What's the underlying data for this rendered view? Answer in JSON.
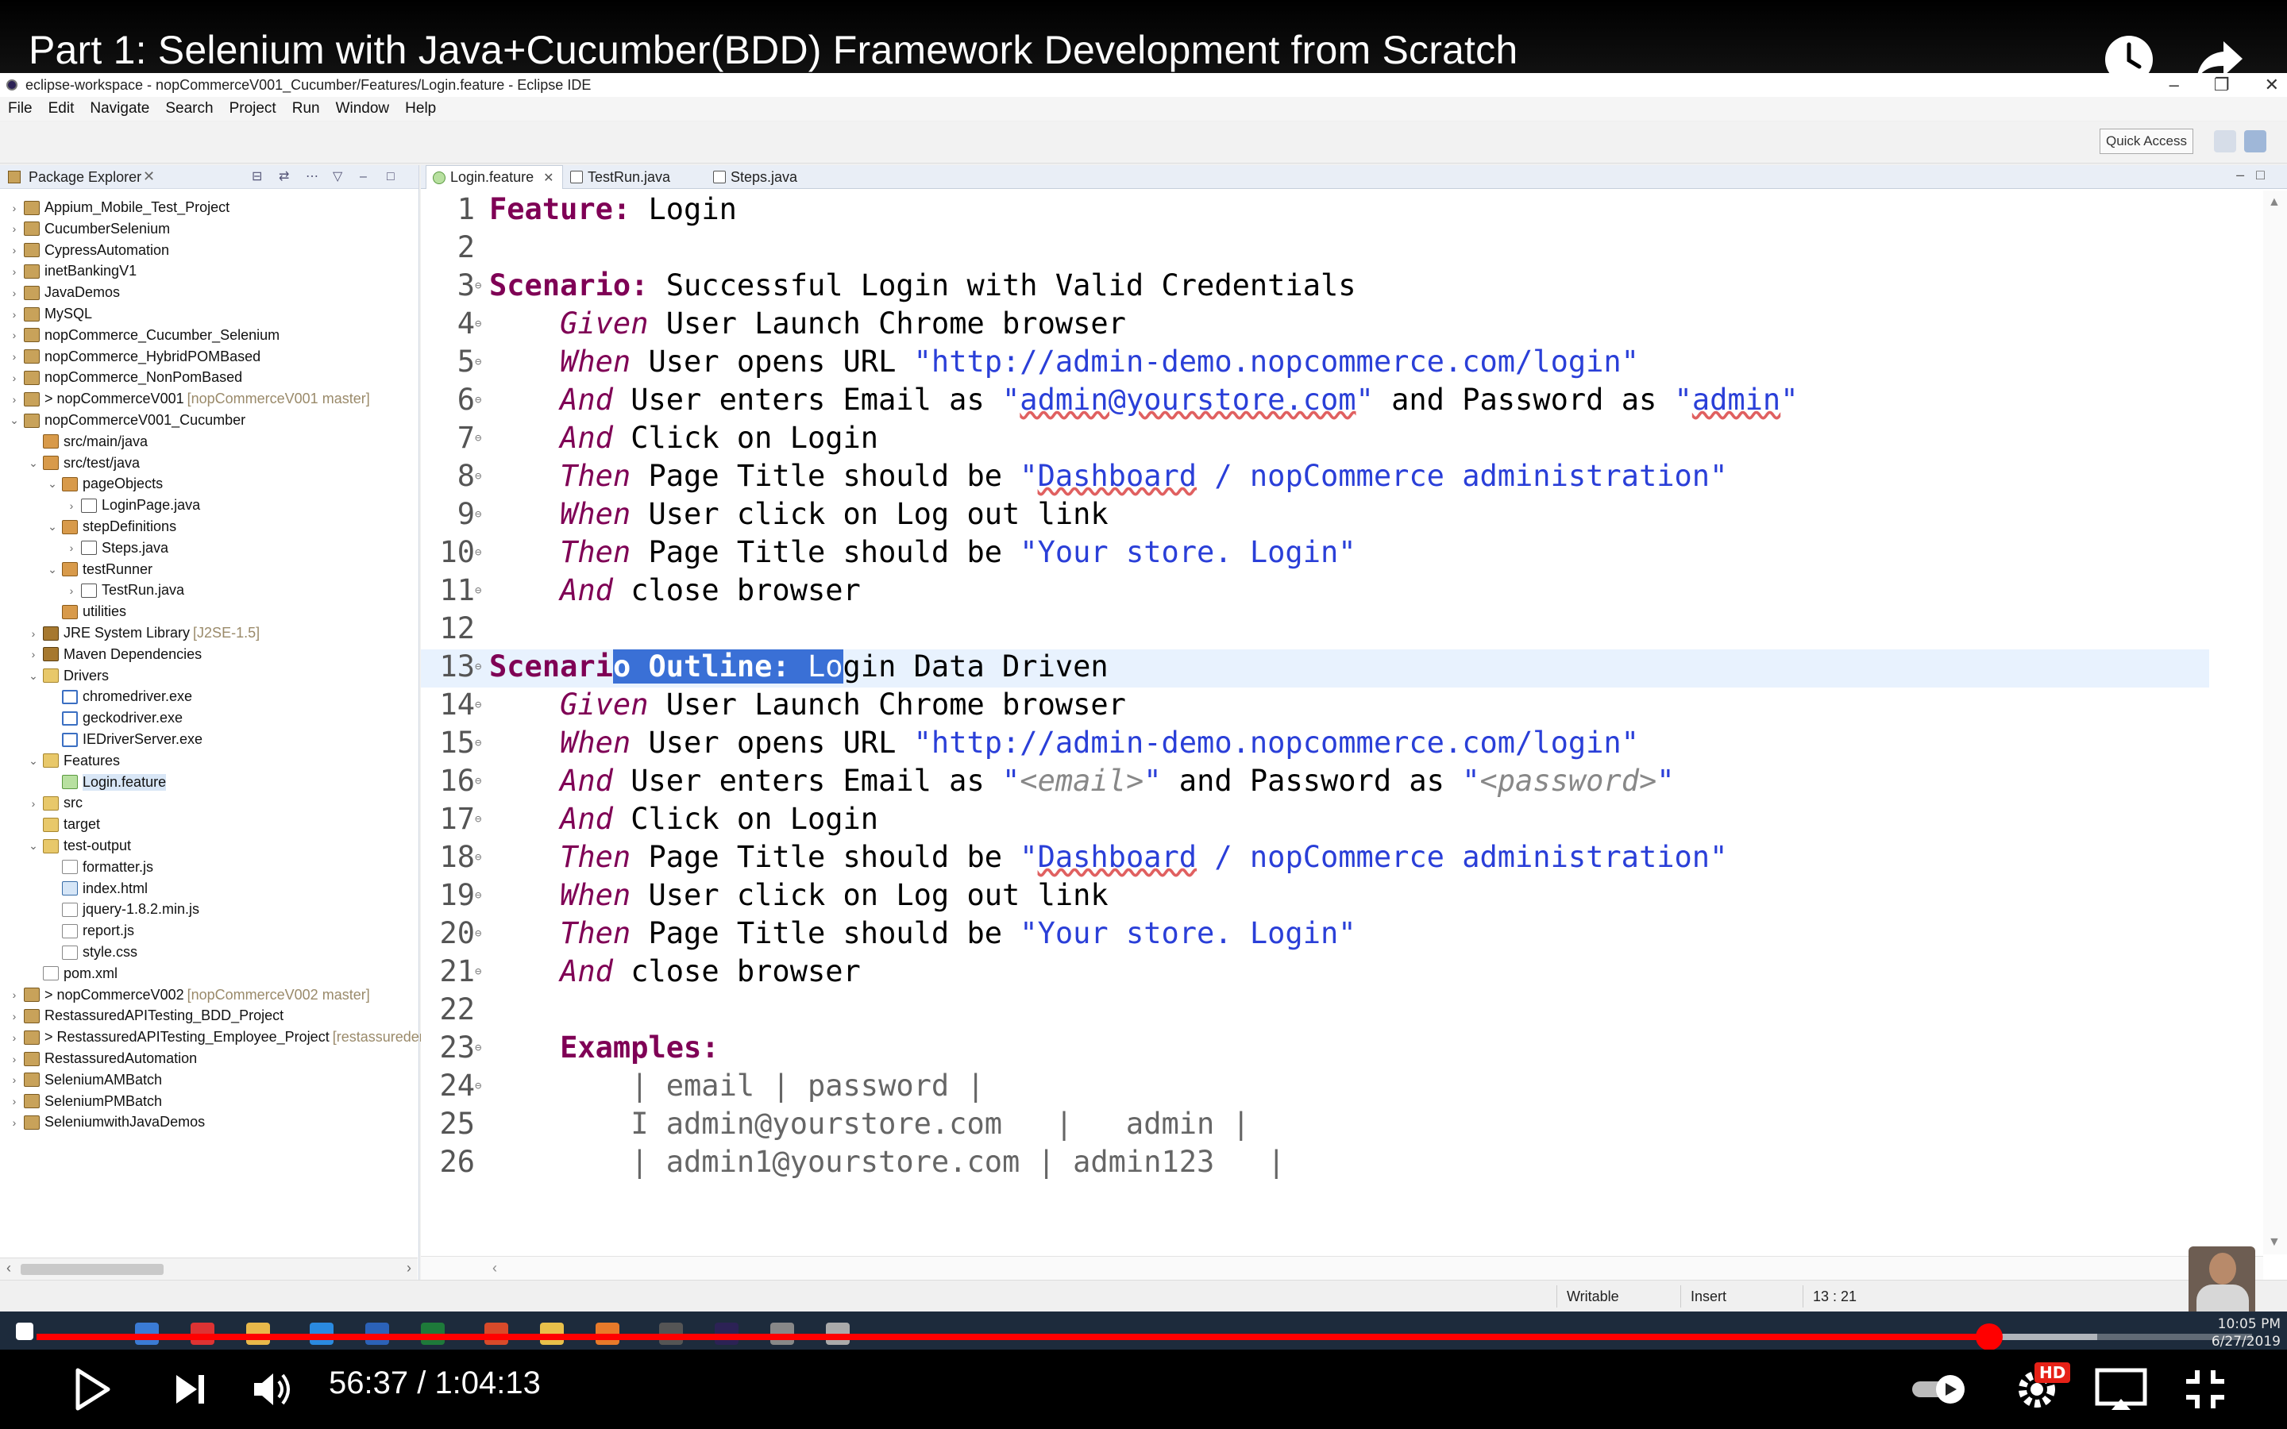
{
  "video": {
    "title": "Part 1: Selenium with Java+Cucumber(BDD) Framework Development from Scratch",
    "current_time": "56:37",
    "duration": "1:04:13",
    "time_display": "56:37 / 1:04:13",
    "progress_fraction": 0.8814,
    "buffered_fraction": 0.93,
    "hd_badge": "HD",
    "colors": {
      "progress": "#ff0000",
      "background": "#000000"
    }
  },
  "eclipse": {
    "window_title": "eclipse-workspace - nopCommerceV001_Cucumber/Features/Login.feature - Eclipse IDE",
    "menu": [
      "File",
      "Edit",
      "Navigate",
      "Search",
      "Project",
      "Run",
      "Window",
      "Help"
    ],
    "quick_access": "Quick Access",
    "package_explorer_title": "Package Explorer",
    "tree": [
      {
        "label": "Appium_Mobile_Test_Project",
        "depth": 0,
        "arrow": "›",
        "icon": "project"
      },
      {
        "label": "CucumberSelenium",
        "depth": 0,
        "arrow": "›",
        "icon": "project"
      },
      {
        "label": "CypressAutomation",
        "depth": 0,
        "arrow": "›",
        "icon": "project"
      },
      {
        "label": "inetBankingV1",
        "depth": 0,
        "arrow": "›",
        "icon": "project"
      },
      {
        "label": "JavaDemos",
        "depth": 0,
        "arrow": "›",
        "icon": "project"
      },
      {
        "label": "MySQL",
        "depth": 0,
        "arrow": "›",
        "icon": "project"
      },
      {
        "label": "nopCommerce_Cucumber_Selenium",
        "depth": 0,
        "arrow": "›",
        "icon": "project"
      },
      {
        "label": "nopCommerce_HybridPOMBased",
        "depth": 0,
        "arrow": "›",
        "icon": "project"
      },
      {
        "label": "nopCommerce_NonPomBased",
        "depth": 0,
        "arrow": "›",
        "icon": "project"
      },
      {
        "label": "> nopCommerceV001",
        "extra": "[nopCommerceV001 master]",
        "depth": 0,
        "arrow": "›",
        "icon": "project"
      },
      {
        "label": "nopCommerceV001_Cucumber",
        "depth": 0,
        "arrow": "⌄",
        "icon": "project"
      },
      {
        "label": "src/main/java",
        "depth": 1,
        "arrow": "",
        "icon": "package"
      },
      {
        "label": "src/test/java",
        "depth": 1,
        "arrow": "⌄",
        "icon": "package"
      },
      {
        "label": "pageObjects",
        "depth": 2,
        "arrow": "⌄",
        "icon": "package"
      },
      {
        "label": "LoginPage.java",
        "depth": 3,
        "arrow": "›",
        "icon": "java"
      },
      {
        "label": "stepDefinitions",
        "depth": 2,
        "arrow": "⌄",
        "icon": "package"
      },
      {
        "label": "Steps.java",
        "depth": 3,
        "arrow": "›",
        "icon": "java"
      },
      {
        "label": "testRunner",
        "depth": 2,
        "arrow": "⌄",
        "icon": "package"
      },
      {
        "label": "TestRun.java",
        "depth": 3,
        "arrow": "›",
        "icon": "java"
      },
      {
        "label": "utilities",
        "depth": 2,
        "arrow": "",
        "icon": "package"
      },
      {
        "label": "JRE System Library",
        "extra": "[J2SE-1.5]",
        "depth": 1,
        "arrow": "›",
        "icon": "lib"
      },
      {
        "label": "Maven Dependencies",
        "depth": 1,
        "arrow": "›",
        "icon": "lib"
      },
      {
        "label": "Drivers",
        "depth": 1,
        "arrow": "⌄",
        "icon": "folder"
      },
      {
        "label": "chromedriver.exe",
        "depth": 2,
        "arrow": "",
        "icon": "exe"
      },
      {
        "label": "geckodriver.exe",
        "depth": 2,
        "arrow": "",
        "icon": "exe"
      },
      {
        "label": "IEDriverServer.exe",
        "depth": 2,
        "arrow": "",
        "icon": "exe"
      },
      {
        "label": "Features",
        "depth": 1,
        "arrow": "⌄",
        "icon": "folder"
      },
      {
        "label": "Login.feature",
        "depth": 2,
        "arrow": "",
        "icon": "feature",
        "selected": true
      },
      {
        "label": "src",
        "depth": 1,
        "arrow": "›",
        "icon": "folder"
      },
      {
        "label": "target",
        "depth": 1,
        "arrow": "",
        "icon": "folder"
      },
      {
        "label": "test-output",
        "depth": 1,
        "arrow": "⌄",
        "icon": "folder"
      },
      {
        "label": "formatter.js",
        "depth": 2,
        "arrow": "",
        "icon": "file"
      },
      {
        "label": "index.html",
        "depth": 2,
        "arrow": "",
        "icon": "html"
      },
      {
        "label": "jquery-1.8.2.min.js",
        "depth": 2,
        "arrow": "",
        "icon": "file"
      },
      {
        "label": "report.js",
        "depth": 2,
        "arrow": "",
        "icon": "file"
      },
      {
        "label": "style.css",
        "depth": 2,
        "arrow": "",
        "icon": "file"
      },
      {
        "label": "pom.xml",
        "depth": 1,
        "arrow": "",
        "icon": "file"
      },
      {
        "label": "> nopCommerceV002",
        "extra": "[nopCommerceV002 master]",
        "depth": 0,
        "arrow": "›",
        "icon": "project"
      },
      {
        "label": "RestassuredAPITesting_BDD_Project",
        "depth": 0,
        "arrow": "›",
        "icon": "project"
      },
      {
        "label": "> RestassuredAPITesting_Employee_Project",
        "extra": "[restassuredemployee",
        "depth": 0,
        "arrow": "›",
        "icon": "project"
      },
      {
        "label": "RestassuredAutomation",
        "depth": 0,
        "arrow": "›",
        "icon": "project"
      },
      {
        "label": "SeleniumAMBatch",
        "depth": 0,
        "arrow": "›",
        "icon": "project"
      },
      {
        "label": "SeleniumPMBatch",
        "depth": 0,
        "arrow": "›",
        "icon": "project"
      },
      {
        "label": "SeleniumwithJavaDemos",
        "depth": 0,
        "arrow": "›",
        "icon": "project"
      }
    ],
    "tabs": [
      {
        "label": "Login.feature",
        "active": true,
        "icon": "feature"
      },
      {
        "label": "TestRun.java",
        "active": false,
        "icon": "java"
      },
      {
        "label": "Steps.java",
        "active": false,
        "icon": "java"
      }
    ],
    "code_lines": [
      {
        "n": "1",
        "fold": false,
        "segs": [
          [
            "kw",
            "Feature:"
          ],
          [
            "",
            " Login"
          ]
        ]
      },
      {
        "n": "2",
        "fold": false,
        "segs": []
      },
      {
        "n": "3",
        "fold": true,
        "segs": [
          [
            "kw",
            "Scenario:"
          ],
          [
            "",
            " Successful Login with Valid Credentials"
          ]
        ]
      },
      {
        "n": "4",
        "fold": true,
        "segs": [
          [
            "",
            "    "
          ],
          [
            "step",
            "Given"
          ],
          [
            "",
            " User Launch Chrome browser"
          ]
        ]
      },
      {
        "n": "5",
        "fold": true,
        "segs": [
          [
            "",
            "    "
          ],
          [
            "step",
            "When"
          ],
          [
            "",
            " User opens URL "
          ],
          [
            "str",
            "\"http://admin-demo.nopcommerce.com/login\""
          ]
        ]
      },
      {
        "n": "6",
        "fold": true,
        "segs": [
          [
            "",
            "    "
          ],
          [
            "step",
            "And"
          ],
          [
            "",
            " User enters Email as "
          ],
          [
            "str",
            "\""
          ],
          [
            "str sq",
            "admin@yourstore.com"
          ],
          [
            "str",
            "\""
          ],
          [
            "",
            " and Password as "
          ],
          [
            "str",
            "\""
          ],
          [
            "str sq",
            "admin"
          ],
          [
            "str",
            "\""
          ]
        ]
      },
      {
        "n": "7",
        "fold": true,
        "segs": [
          [
            "",
            "    "
          ],
          [
            "step",
            "And"
          ],
          [
            "",
            " Click on Login"
          ]
        ]
      },
      {
        "n": "8",
        "fold": true,
        "segs": [
          [
            "",
            "    "
          ],
          [
            "step",
            "Then"
          ],
          [
            "",
            " Page Title should be "
          ],
          [
            "str",
            "\""
          ],
          [
            "str sq",
            "Dashboard"
          ],
          [
            "str",
            " / nopCommerce administration\""
          ]
        ]
      },
      {
        "n": "9",
        "fold": true,
        "segs": [
          [
            "",
            "    "
          ],
          [
            "step",
            "When"
          ],
          [
            "",
            " User click on Log out link"
          ]
        ]
      },
      {
        "n": "10",
        "fold": true,
        "segs": [
          [
            "",
            "    "
          ],
          [
            "step",
            "Then"
          ],
          [
            "",
            " Page Title should be "
          ],
          [
            "str",
            "\"Your store. Login\""
          ]
        ]
      },
      {
        "n": "11",
        "fold": true,
        "segs": [
          [
            "",
            "    "
          ],
          [
            "step",
            "And"
          ],
          [
            "",
            " close browser"
          ]
        ]
      },
      {
        "n": "12",
        "fold": false,
        "segs": []
      },
      {
        "n": "13",
        "fold": true,
        "current": true,
        "segs": [
          [
            "kw",
            "Scenari"
          ],
          [
            "kw sel",
            "o Outline:"
          ],
          [
            "sel",
            " Lo"
          ],
          [
            "",
            "gin Data Driven"
          ]
        ]
      },
      {
        "n": "14",
        "fold": true,
        "segs": [
          [
            "",
            "    "
          ],
          [
            "step",
            "Given"
          ],
          [
            "",
            " User Launch Chrome browser"
          ]
        ]
      },
      {
        "n": "15",
        "fold": true,
        "segs": [
          [
            "",
            "    "
          ],
          [
            "step",
            "When"
          ],
          [
            "",
            " User opens URL "
          ],
          [
            "str",
            "\"http://admin-demo.nopcommerce.com/login\""
          ]
        ]
      },
      {
        "n": "16",
        "fold": true,
        "segs": [
          [
            "",
            "    "
          ],
          [
            "step",
            "And"
          ],
          [
            "",
            " User enters Email as "
          ],
          [
            "str",
            "\""
          ],
          [
            "ph",
            "<email>"
          ],
          [
            "str",
            "\""
          ],
          [
            "",
            " and Password as "
          ],
          [
            "str",
            "\""
          ],
          [
            "ph",
            "<password>"
          ],
          [
            "str",
            "\""
          ]
        ]
      },
      {
        "n": "17",
        "fold": true,
        "segs": [
          [
            "",
            "    "
          ],
          [
            "step",
            "And"
          ],
          [
            "",
            " Click on Login"
          ]
        ]
      },
      {
        "n": "18",
        "fold": true,
        "segs": [
          [
            "",
            "    "
          ],
          [
            "step",
            "Then"
          ],
          [
            "",
            " Page Title should be "
          ],
          [
            "str",
            "\""
          ],
          [
            "str sq",
            "Dashboard"
          ],
          [
            "str",
            " / nopCommerce administration\""
          ]
        ]
      },
      {
        "n": "19",
        "fold": true,
        "segs": [
          [
            "",
            "    "
          ],
          [
            "step",
            "When"
          ],
          [
            "",
            " User click on Log out link"
          ]
        ]
      },
      {
        "n": "20",
        "fold": true,
        "segs": [
          [
            "",
            "    "
          ],
          [
            "step",
            "Then"
          ],
          [
            "",
            " Page Title should be "
          ],
          [
            "str",
            "\"Your store. Login\""
          ]
        ]
      },
      {
        "n": "21",
        "fold": true,
        "segs": [
          [
            "",
            "    "
          ],
          [
            "step",
            "And"
          ],
          [
            "",
            " close browser"
          ]
        ]
      },
      {
        "n": "22",
        "fold": false,
        "segs": []
      },
      {
        "n": "23",
        "fold": true,
        "segs": [
          [
            "",
            "    "
          ],
          [
            "kw",
            "Examples:"
          ]
        ]
      },
      {
        "n": "24",
        "fold": true,
        "segs": [
          [
            "tbl",
            "        | email | password |"
          ]
        ]
      },
      {
        "n": "25",
        "fold": false,
        "segs": [
          [
            "tbl",
            "        I admin@yourstore.com   |   admin |"
          ]
        ]
      },
      {
        "n": "26",
        "fold": false,
        "segs": [
          [
            "tbl",
            "        | admin1@yourstore.com | admin123   |"
          ]
        ]
      }
    ],
    "status": {
      "writable": "Writable",
      "insert": "Insert",
      "position": "13 : 21"
    },
    "taskbar": {
      "time": "10:05 PM",
      "date": "6/27/2019"
    }
  }
}
